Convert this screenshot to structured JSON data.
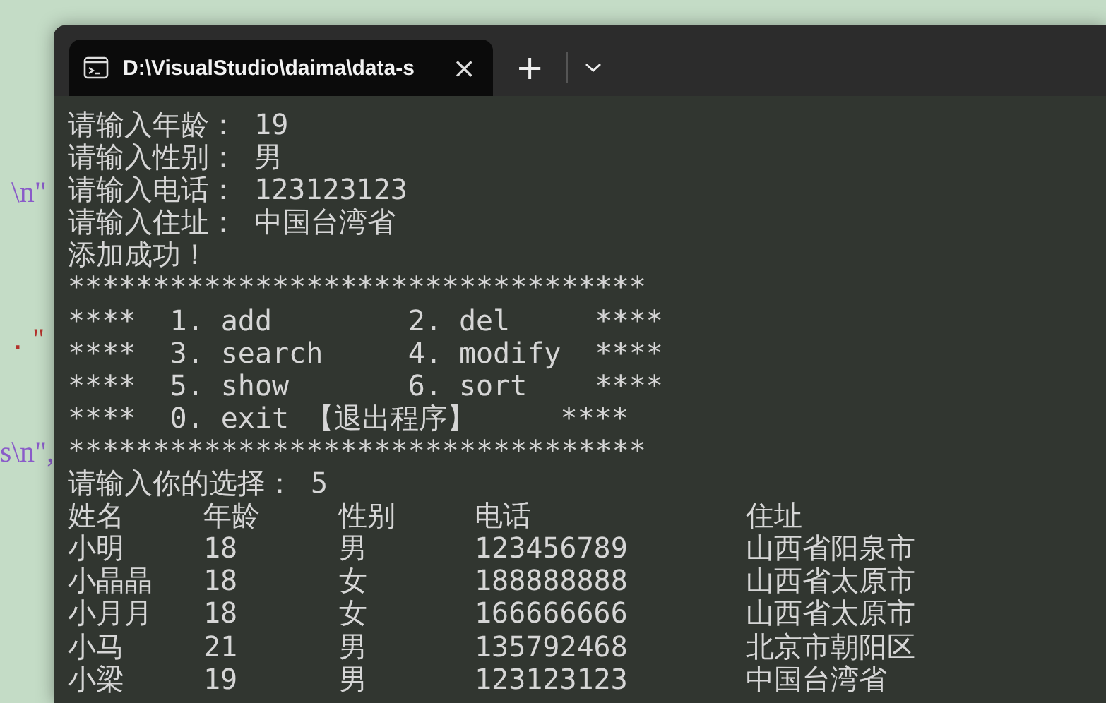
{
  "editor_fragments": [
    "\\n\"",
    "．\"",
    "s\\n\","
  ],
  "tab": {
    "title": "D:\\VisualStudio\\daima\\data-s",
    "close": "×",
    "selected": true
  },
  "new_tab": "+",
  "console_lines": [
    "请输入年龄： 19",
    "请输入性别： 男",
    "请输入电话： 123123123",
    "请输入住址： 中国台湾省",
    "添加成功！",
    "**********************************",
    "****  1. add        2. del     ****",
    "****  3. search     4. modify  ****",
    "****  5. show       6. sort    ****",
    "****  0. exit 【退出程序】     ****",
    "**********************************",
    "请输入你的选择： 5"
  ],
  "table": {
    "columns": [
      "姓名",
      "年龄",
      "性别",
      "电话",
      "住址"
    ],
    "rows": [
      [
        "小明",
        "18",
        "男",
        "123456789",
        "山西省阳泉市"
      ],
      [
        "小晶晶",
        "18",
        "女",
        "188888888",
        "山西省太原市"
      ],
      [
        "小月月",
        "18",
        "女",
        "166666666",
        "山西省太原市"
      ],
      [
        "小马",
        "21",
        "男",
        "135792468",
        "北京市朝阳区"
      ],
      [
        "小梁",
        "19",
        "男",
        "123123123",
        "中国台湾省"
      ]
    ]
  }
}
